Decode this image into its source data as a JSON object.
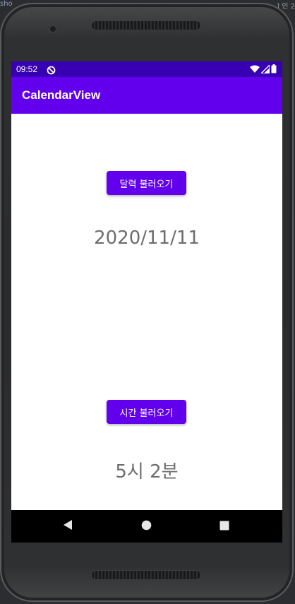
{
  "background": {
    "left_hint": "sho",
    "right_hint": "] 인 2"
  },
  "status_bar": {
    "time": "09:52",
    "sync_icon": "sync-disabled-icon",
    "wifi_icon": "wifi-icon",
    "signal_icon": "cell-signal-icon",
    "battery_icon": "battery-icon"
  },
  "app_bar": {
    "title": "CalendarView"
  },
  "main": {
    "calendar_button_label": "달력 불러오기",
    "date_value": "2020/11/11",
    "time_button_label": "시간 불러오기",
    "time_value": "5시 2분"
  },
  "nav_bar": {
    "back_icon": "back-triangle-icon",
    "home_icon": "home-circle-icon",
    "recents_icon": "recents-square-icon"
  },
  "colors": {
    "primary": "#6200ee",
    "primary_dark": "#3700b3",
    "value_text": "#6d6d6d",
    "screen_bg": "#ffffff"
  }
}
